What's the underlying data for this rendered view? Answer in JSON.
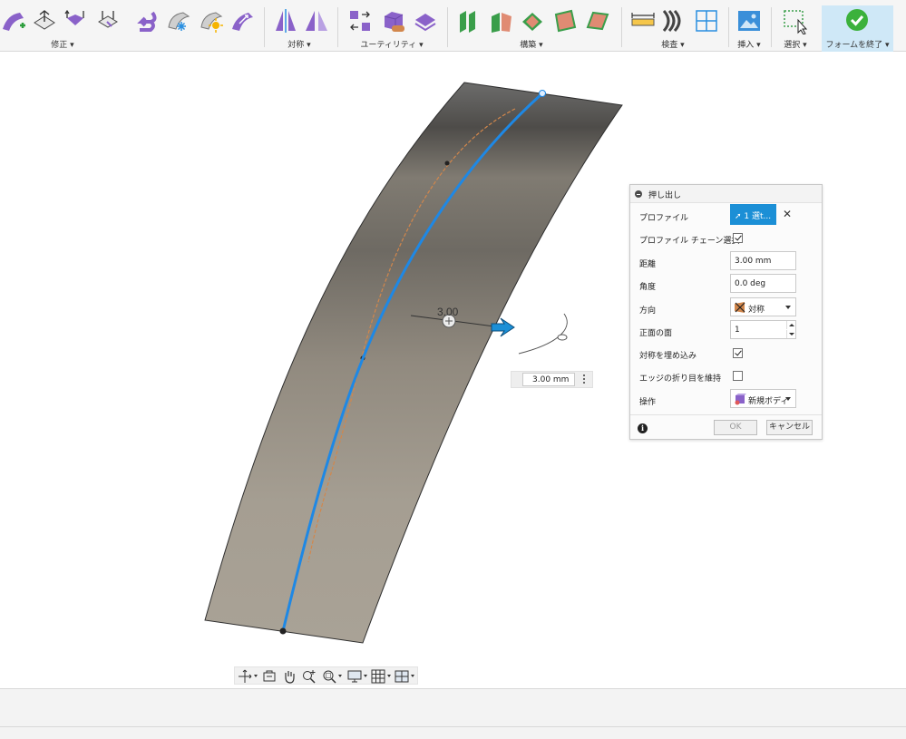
{
  "toolbar": {
    "groups": [
      {
        "label": "修正 ▾"
      },
      {
        "label": "対称 ▾"
      },
      {
        "label": "ユーティリティ ▾"
      },
      {
        "label": "構築 ▾"
      },
      {
        "label": "検査 ▾"
      },
      {
        "label": "挿入 ▾"
      },
      {
        "label": "選択 ▾"
      },
      {
        "label": "フォームを終了 ▾"
      }
    ]
  },
  "canvas": {
    "dimension_label": "3.00"
  },
  "dimension_input": {
    "value": "3.00 mm"
  },
  "extrude_panel": {
    "title": "押し出し",
    "profile_label": "プロファイル",
    "profile_value": "1 選t...",
    "chain_label": "プロファイル チェーン選択",
    "chain_checked": true,
    "distance_label": "距離",
    "distance_value": "3.00 mm",
    "angle_label": "角度",
    "angle_value": "0.0 deg",
    "direction_label": "方向",
    "direction_value": "対称",
    "faces_label": "正面の面",
    "faces_value": "1",
    "embed_label": "対称を埋め込み",
    "embed_checked": true,
    "crease_label": "エッジの折り目を維持",
    "crease_checked": false,
    "operation_label": "操作",
    "operation_value": "新規ボディ",
    "ok_label": "OK",
    "cancel_label": "キャンセル"
  },
  "colors": {
    "accent": "#1b8fd6",
    "finish_check": "#3cb13c",
    "curve": "#1e88e5",
    "sketch": "#d2874c"
  }
}
